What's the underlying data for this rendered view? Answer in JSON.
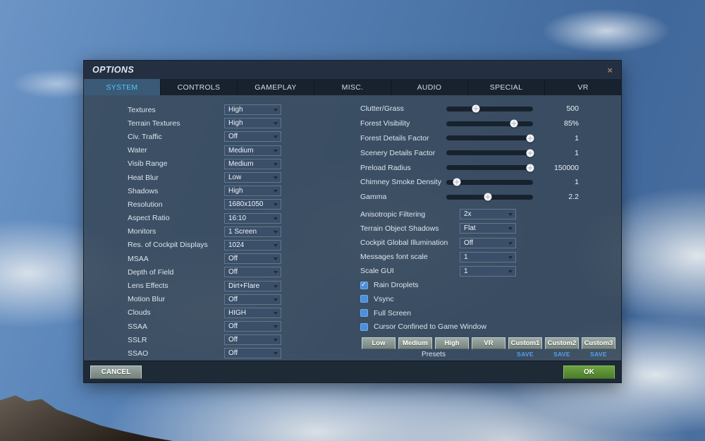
{
  "window": {
    "title": "OPTIONS",
    "close_icon": "×"
  },
  "tabs": [
    {
      "label": "SYSTEM",
      "active": true
    },
    {
      "label": "CONTROLS",
      "active": false
    },
    {
      "label": "GAMEPLAY",
      "active": false
    },
    {
      "label": "MISC.",
      "active": false
    },
    {
      "label": "AUDIO",
      "active": false
    },
    {
      "label": "SPECIAL",
      "active": false
    },
    {
      "label": "VR",
      "active": false
    }
  ],
  "left_settings": [
    {
      "label": "Textures",
      "value": "High"
    },
    {
      "label": "Terrain Textures",
      "value": "High"
    },
    {
      "label": "Civ. Traffic",
      "value": "Off"
    },
    {
      "label": "Water",
      "value": "Medium"
    },
    {
      "label": "Visib Range",
      "value": "Medium"
    },
    {
      "label": "Heat Blur",
      "value": "Low"
    },
    {
      "label": "Shadows",
      "value": "High"
    },
    {
      "label": "Resolution",
      "value": "1680x1050"
    },
    {
      "label": "Aspect Ratio",
      "value": "16:10"
    },
    {
      "label": "Monitors",
      "value": "1 Screen"
    },
    {
      "label": "Res. of Cockpit Displays",
      "value": "1024"
    },
    {
      "label": "MSAA",
      "value": "Off"
    },
    {
      "label": "Depth of Field",
      "value": "Off"
    },
    {
      "label": "Lens Effects",
      "value": "Dirt+Flare"
    },
    {
      "label": "Motion Blur",
      "value": "Off"
    },
    {
      "label": "Clouds",
      "value": "HIGH"
    },
    {
      "label": "SSAA",
      "value": "Off"
    },
    {
      "label": "SSLR",
      "value": "Off"
    },
    {
      "label": "SSAO",
      "value": "Off"
    }
  ],
  "sliders": [
    {
      "label": "Clutter/Grass",
      "value": "500",
      "pct": 34
    },
    {
      "label": "Forest Visibility",
      "value": "85%",
      "pct": 78
    },
    {
      "label": "Forest Details Factor",
      "value": "1",
      "pct": 97
    },
    {
      "label": "Scenery Details Factor",
      "value": "1",
      "pct": 97
    },
    {
      "label": "Preload Radius",
      "value": "150000",
      "pct": 97
    },
    {
      "label": "Chimney Smoke Density",
      "value": "1",
      "pct": 12
    },
    {
      "label": "Gamma",
      "value": "2.2",
      "pct": 48
    }
  ],
  "right_settings": [
    {
      "label": "Anisotropic Filtering",
      "value": "2x"
    },
    {
      "label": "Terrain Object Shadows",
      "value": "Flat"
    },
    {
      "label": "Cockpit Global Illumination",
      "value": "Off"
    },
    {
      "label": "Messages font scale",
      "value": "1"
    },
    {
      "label": "Scale GUI",
      "value": "1"
    }
  ],
  "checkboxes": [
    {
      "label": "Rain Droplets",
      "checked": true
    },
    {
      "label": "Vsync",
      "checked": false
    },
    {
      "label": "Full Screen",
      "checked": false
    },
    {
      "label": "Cursor Confined to Game Window",
      "checked": false
    }
  ],
  "presets": {
    "caption": "Presets",
    "save_label": "SAVE",
    "buttons": [
      "Low",
      "Medium",
      "High",
      "VR",
      "Custom1",
      "Custom2",
      "Custom3"
    ]
  },
  "footer": {
    "cancel_label": "CANCEL",
    "ok_label": "OK"
  },
  "colors": {
    "accent_cyan": "#4fc8f2",
    "ok_green": "#5c8d34",
    "save_blue": "#57a0e8",
    "checkbox_blue": "#4a90da"
  }
}
